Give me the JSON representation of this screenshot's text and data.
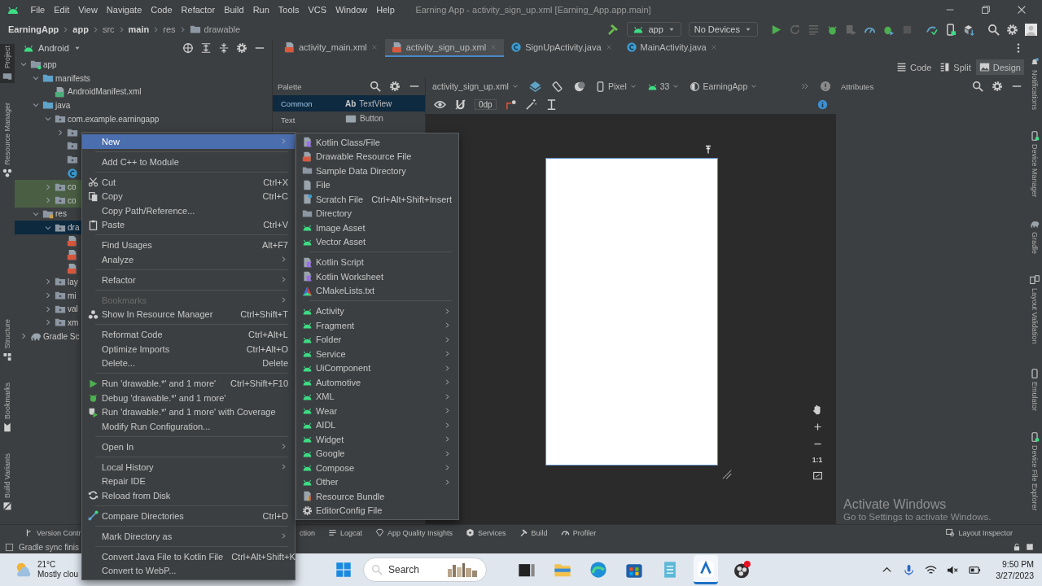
{
  "title_bar": {
    "menus": [
      "File",
      "Edit",
      "View",
      "Navigate",
      "Code",
      "Refactor",
      "Build",
      "Run",
      "Tools",
      "VCS",
      "Window",
      "Help"
    ],
    "title": "Earning App - activity_sign_up.xml [Earning_App.app.main]"
  },
  "nav_bar": {
    "breadcrumbs": [
      {
        "label": "EarningApp",
        "bold": true
      },
      {
        "label": "app",
        "bold": true
      },
      {
        "label": "src",
        "bold": false
      },
      {
        "label": "main",
        "bold": true
      },
      {
        "label": "res",
        "bold": false
      },
      {
        "label": "drawable",
        "bold": false,
        "kind": "folder"
      }
    ],
    "run_config": "app",
    "device": "No Devices"
  },
  "left_strip": {
    "top": [
      {
        "label": "Project",
        "kind": "folder",
        "selected": true
      },
      {
        "label": "Resource Manager",
        "kind": "resource",
        "selected": false
      }
    ],
    "bottom": [
      {
        "label": "Structure",
        "kind": "structure",
        "selected": false
      },
      {
        "label": "Bookmarks",
        "kind": "bookmark",
        "selected": false
      },
      {
        "label": "Build Variants",
        "kind": "variants",
        "selected": false
      }
    ]
  },
  "right_strip": {
    "top": [
      {
        "label": "Notifications",
        "kind": "bell"
      },
      {
        "label": "Device Manager",
        "kind": "device"
      },
      {
        "label": "Gradle",
        "kind": "elephant"
      },
      {
        "label": "Layout Validation",
        "kind": "devices"
      }
    ],
    "bottom": [
      {
        "label": "Emulator",
        "kind": "phone"
      },
      {
        "label": "Device File Explorer",
        "kind": "device"
      }
    ]
  },
  "project_panel": {
    "view": "Android",
    "tree": [
      {
        "kind": "module",
        "label": "app",
        "expanded": true,
        "selected": false,
        "test": false,
        "children": [
          {
            "kind": "folder_blue",
            "label": "manifests",
            "expanded": true,
            "selected": false,
            "test": false,
            "children": [
              {
                "kind": "manifest",
                "label": "AndroidManifest.xml",
                "selected": false,
                "test": false
              }
            ]
          },
          {
            "kind": "folder_blue",
            "label": "java",
            "expanded": true,
            "selected": false,
            "test": false,
            "children": [
              {
                "kind": "package",
                "label": "com.example.earningapp",
                "expanded": true,
                "selected": false,
                "test": false,
                "children": [
                  {
                    "kind": "package",
                    "expanded": false,
                    "selected": false,
                    "test": false
                  },
                  {
                    "kind": "package",
                    "selected": false,
                    "test": false
                  },
                  {
                    "kind": "package",
                    "selected": false,
                    "test": false
                  },
                  {
                    "kind": "class",
                    "selected": false,
                    "test": false
                  }
                ]
              },
              {
                "kind": "package",
                "label": "co",
                "expanded": false,
                "selected": false,
                "test": true
              },
              {
                "kind": "package",
                "label": "co",
                "expanded": false,
                "selected": false,
                "test": true
              }
            ]
          },
          {
            "kind": "res",
            "label": "res",
            "expanded": true,
            "selected": false,
            "test": false,
            "children": [
              {
                "kind": "package",
                "label": "dra",
                "expanded": true,
                "selected": true,
                "test": false,
                "children": [
                  {
                    "kind": "drawable",
                    "selected": false,
                    "test": false
                  },
                  {
                    "kind": "drawable",
                    "selected": false,
                    "test": false
                  },
                  {
                    "kind": "drawable",
                    "selected": false,
                    "test": false
                  }
                ]
              },
              {
                "kind": "package",
                "label": "lay",
                "expanded": false,
                "selected": false,
                "test": false
              },
              {
                "kind": "package",
                "label": "mi",
                "expanded": false,
                "selected": false,
                "test": false
              },
              {
                "kind": "package",
                "label": "val",
                "expanded": false,
                "selected": false,
                "test": false
              },
              {
                "kind": "package",
                "label": "xm",
                "expanded": false,
                "selected": false,
                "test": false
              }
            ]
          }
        ]
      },
      {
        "kind": "elephant",
        "label": "Gradle Sc",
        "expanded": false,
        "selected": false,
        "test": false
      }
    ]
  },
  "editor_tabs": [
    {
      "label": "activity_main.xml",
      "kind": "layout",
      "selected": false
    },
    {
      "label": "activity_sign_up.xml",
      "kind": "layout",
      "selected": true
    },
    {
      "label": "SignUpActivity.java",
      "kind": "class",
      "selected": false
    },
    {
      "label": "MainActivity.java",
      "kind": "class",
      "selected": false
    }
  ],
  "view_modes": [
    {
      "label": "Code",
      "kind": "code",
      "selected": false
    },
    {
      "label": "Split",
      "kind": "split",
      "selected": false
    },
    {
      "label": "Design",
      "kind": "design",
      "selected": true
    }
  ],
  "palette": {
    "title": "Palette",
    "categories": [
      {
        "label": "Common",
        "selected": true
      },
      {
        "label": "Text",
        "selected": false
      }
    ],
    "items": [
      {
        "label": "TextView",
        "glyph": "Ab",
        "selected": true
      },
      {
        "label": "Button",
        "kind": "button",
        "selected": false
      }
    ]
  },
  "design_toolbar": {
    "file": "activity_sign_up.xml",
    "device": "Pixel",
    "api": "33",
    "theme": "EarningApp",
    "margin": "0dp"
  },
  "zoom_controls": {
    "ratio": "1:1"
  },
  "attributes": {
    "title": "Attributes"
  },
  "context_menu": [
    {
      "kind": "plain",
      "label": "New",
      "submenu": true,
      "disabled": false,
      "selected": true
    },
    {
      "kind": "separator"
    },
    {
      "kind": "plain",
      "label": "Add C++ to Module",
      "submenu": false,
      "disabled": false,
      "selected": false
    },
    {
      "kind": "separator"
    },
    {
      "kind": "cut",
      "label": "Cut",
      "shortcut": "Ctrl+X",
      "submenu": false,
      "disabled": false,
      "selected": false
    },
    {
      "kind": "copy",
      "label": "Copy",
      "shortcut": "Ctrl+C",
      "submenu": false,
      "disabled": false,
      "selected": false
    },
    {
      "kind": "plain",
      "label": "Copy Path/Reference...",
      "submenu": false,
      "disabled": false,
      "selected": false
    },
    {
      "kind": "paste",
      "label": "Paste",
      "shortcut": "Ctrl+V",
      "submenu": false,
      "disabled": false,
      "selected": false
    },
    {
      "kind": "separator"
    },
    {
      "kind": "plain",
      "label": "Find Usages",
      "shortcut": "Alt+F7",
      "submenu": false,
      "disabled": false,
      "selected": false
    },
    {
      "kind": "plain",
      "label": "Analyze",
      "submenu": true,
      "disabled": false,
      "selected": false
    },
    {
      "kind": "separator"
    },
    {
      "kind": "plain",
      "label": "Refactor",
      "submenu": true,
      "disabled": false,
      "selected": false
    },
    {
      "kind": "separator"
    },
    {
      "kind": "plain",
      "label": "Bookmarks",
      "submenu": true,
      "disabled": true,
      "selected": false
    },
    {
      "kind": "resource",
      "label": "Show In Resource Manager",
      "shortcut": "Ctrl+Shift+T",
      "submenu": false,
      "disabled": false,
      "selected": false
    },
    {
      "kind": "separator"
    },
    {
      "kind": "plain",
      "label": "Reformat Code",
      "shortcut": "Ctrl+Alt+L",
      "submenu": false,
      "disabled": false,
      "selected": false
    },
    {
      "kind": "plain",
      "label": "Optimize Imports",
      "shortcut": "Ctrl+Alt+O",
      "submenu": false,
      "disabled": false,
      "selected": false
    },
    {
      "kind": "plain",
      "label": "Delete...",
      "shortcut": "Delete",
      "submenu": false,
      "disabled": false,
      "selected": false
    },
    {
      "kind": "separator"
    },
    {
      "kind": "run",
      "label": "Run 'drawable.*' and 1 more'",
      "shortcut": "Ctrl+Shift+F10",
      "submenu": false,
      "disabled": false,
      "selected": false
    },
    {
      "kind": "debug",
      "label": "Debug 'drawable.*' and 1 more'",
      "submenu": false,
      "disabled": false,
      "selected": false
    },
    {
      "kind": "coverage",
      "label": "Run 'drawable.*' and 1 more' with Coverage",
      "submenu": false,
      "disabled": false,
      "selected": false
    },
    {
      "kind": "plain",
      "label": "Modify Run Configuration...",
      "submenu": false,
      "disabled": false,
      "selected": false
    },
    {
      "kind": "separator"
    },
    {
      "kind": "plain",
      "label": "Open In",
      "submenu": true,
      "disabled": false,
      "selected": false
    },
    {
      "kind": "separator"
    },
    {
      "kind": "plain",
      "label": "Local History",
      "submenu": true,
      "disabled": false,
      "selected": false
    },
    {
      "kind": "plain",
      "label": "Repair IDE",
      "submenu": false,
      "disabled": false,
      "selected": false
    },
    {
      "kind": "reload",
      "label": "Reload from Disk",
      "submenu": false,
      "disabled": false,
      "selected": false
    },
    {
      "kind": "separator"
    },
    {
      "kind": "compare",
      "label": "Compare Directories",
      "shortcut": "Ctrl+D",
      "submenu": false,
      "disabled": false,
      "selected": false
    },
    {
      "kind": "separator"
    },
    {
      "kind": "plain",
      "label": "Mark Directory as",
      "submenu": true,
      "disabled": false,
      "selected": false
    },
    {
      "kind": "separator"
    },
    {
      "kind": "plain",
      "label": "Convert Java File to Kotlin File",
      "shortcut": "Ctrl+Alt+Shift+K",
      "submenu": false,
      "disabled": false,
      "selected": false
    },
    {
      "kind": "plain",
      "label": "Convert to WebP...",
      "submenu": false,
      "disabled": false,
      "selected": false
    }
  ],
  "new_submenu": [
    {
      "kind": "kotlin",
      "label": "Kotlin Class/File",
      "submenu": false
    },
    {
      "kind": "drawable",
      "label": "Drawable Resource File",
      "submenu": false
    },
    {
      "kind": "folder",
      "label": "Sample Data Directory",
      "submenu": false
    },
    {
      "kind": "file",
      "label": "File",
      "submenu": false
    },
    {
      "kind": "scratch",
      "label": "Scratch File",
      "shortcut": "Ctrl+Alt+Shift+Insert",
      "submenu": false
    },
    {
      "kind": "folder",
      "label": "Directory",
      "submenu": false
    },
    {
      "kind": "android",
      "label": "Image Asset",
      "submenu": false
    },
    {
      "kind": "android",
      "label": "Vector Asset",
      "submenu": false
    },
    {
      "kind": "separator"
    },
    {
      "kind": "kotlin",
      "label": "Kotlin Script",
      "submenu": false
    },
    {
      "kind": "kotlin",
      "label": "Kotlin Worksheet",
      "submenu": false
    },
    {
      "kind": "cmake",
      "label": "CMakeLists.txt",
      "submenu": false
    },
    {
      "kind": "separator"
    },
    {
      "kind": "android",
      "label": "Activity",
      "submenu": true
    },
    {
      "kind": "android",
      "label": "Fragment",
      "submenu": true
    },
    {
      "kind": "android",
      "label": "Folder",
      "submenu": true
    },
    {
      "kind": "android",
      "label": "Service",
      "submenu": true
    },
    {
      "kind": "android",
      "label": "UiComponent",
      "submenu": true
    },
    {
      "kind": "android",
      "label": "Automotive",
      "submenu": true
    },
    {
      "kind": "android",
      "label": "XML",
      "submenu": true
    },
    {
      "kind": "android",
      "label": "Wear",
      "submenu": true
    },
    {
      "kind": "android",
      "label": "AIDL",
      "submenu": true
    },
    {
      "kind": "android",
      "label": "Widget",
      "submenu": true
    },
    {
      "kind": "android",
      "label": "Google",
      "submenu": true
    },
    {
      "kind": "android",
      "label": "Compose",
      "submenu": true
    },
    {
      "kind": "android",
      "label": "Other",
      "submenu": true
    },
    {
      "kind": "bundle",
      "label": "Resource Bundle",
      "submenu": false
    },
    {
      "kind": "gear",
      "label": "EditorConfig File",
      "submenu": false
    }
  ],
  "bottom_bar": {
    "tabs": [
      {
        "label": "Version Contr",
        "kind": "vcs"
      },
      {
        "label": "ction"
      },
      {
        "label": "Logcat",
        "kind": "logcat"
      },
      {
        "label": "App Quality Insights",
        "kind": "quality"
      },
      {
        "label": "Services",
        "kind": "services"
      },
      {
        "label": "Build",
        "kind": "build"
      },
      {
        "label": "Profiler",
        "kind": "profiler"
      }
    ],
    "right_tabs": [
      {
        "label": "Layout Inspector",
        "kind": "inspector"
      }
    ]
  },
  "status_bar": {
    "message": "Gradle sync finis"
  },
  "os_notice": {
    "heading": "Activate Windows",
    "text": "Go to Settings to activate Windows."
  },
  "taskbar": {
    "temperature": "21°C",
    "weather": "Mostly clou",
    "search": {
      "placeholder": "Search"
    },
    "apps": [
      {
        "kind": "taskview",
        "selected": false
      },
      {
        "kind": "explorer",
        "selected": false
      },
      {
        "kind": "browser",
        "selected": false
      },
      {
        "kind": "store",
        "selected": false
      },
      {
        "kind": "notepad",
        "selected": false
      },
      {
        "kind": "studio",
        "selected": true
      },
      {
        "kind": "recorder",
        "selected": false
      }
    ],
    "time": "9:50 PM",
    "date": "3/27/2023"
  }
}
